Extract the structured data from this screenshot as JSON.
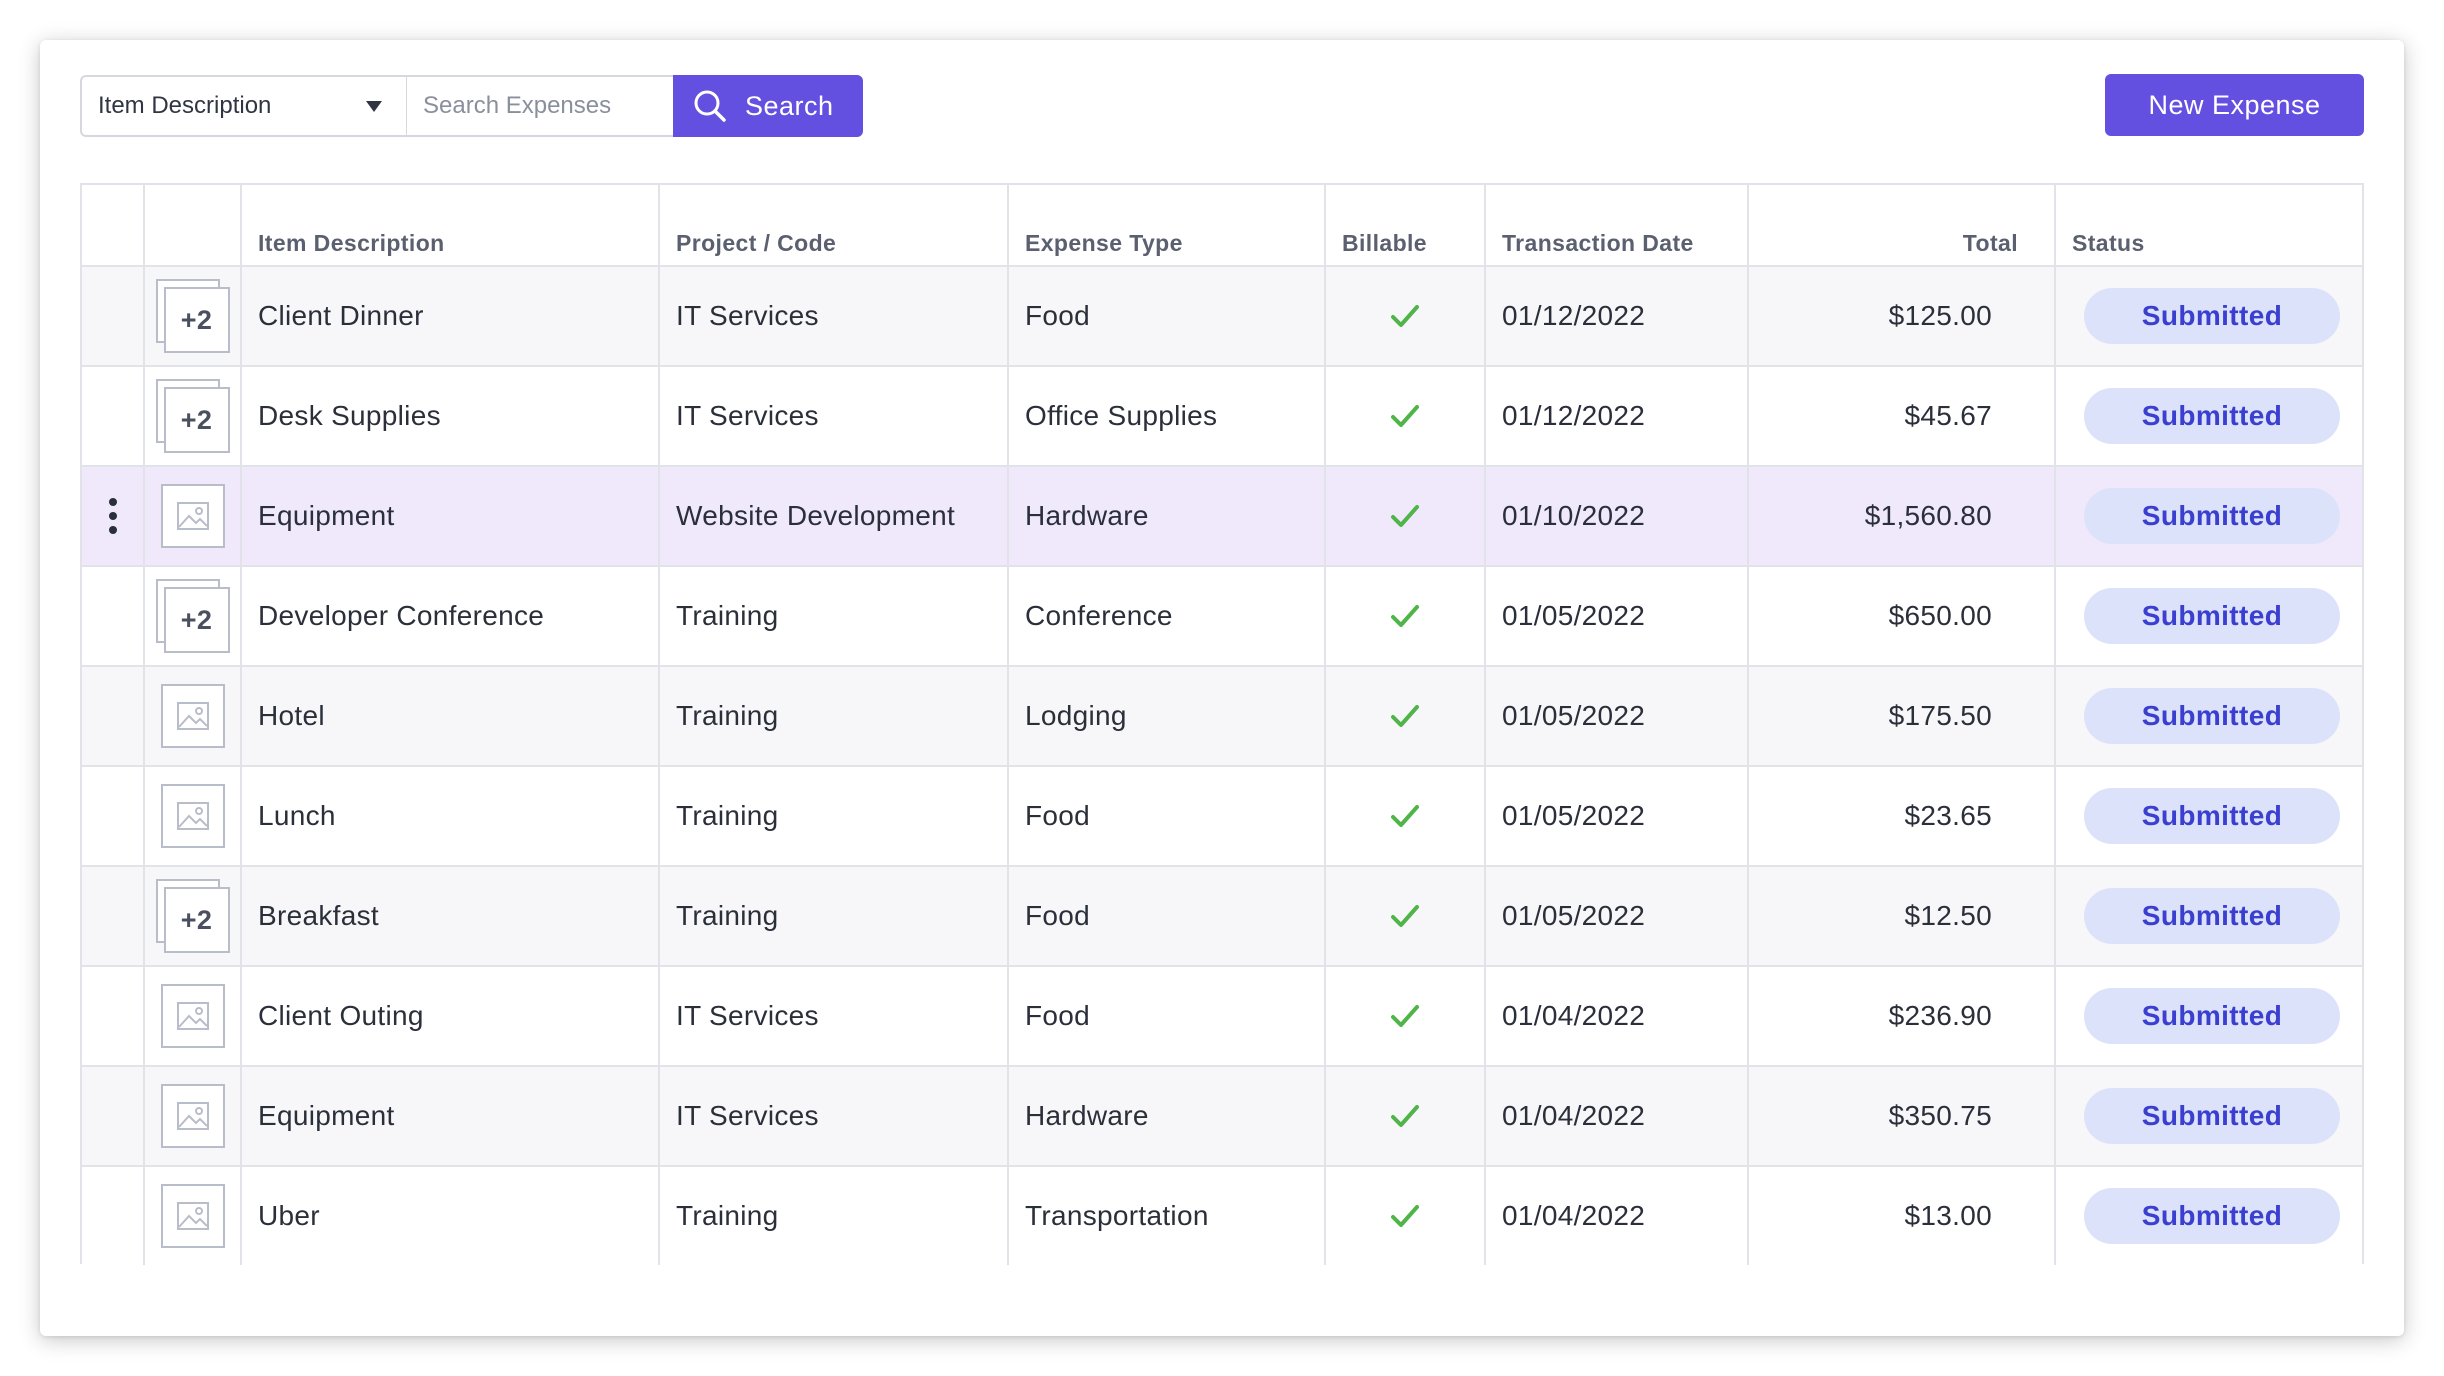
{
  "toolbar": {
    "filter_field": "Item Description",
    "search_placeholder": "Search Expenses",
    "search_label": "Search",
    "new_expense_label": "New Expense"
  },
  "colors": {
    "accent": "#6450e0",
    "badge_bg": "#dde2fb",
    "badge_text": "#3a3fd0",
    "check": "#4fb548",
    "selected_row": "#efe9fb"
  },
  "table": {
    "columns": [
      "Item Description",
      "Project / Code",
      "Expense Type",
      "Billable",
      "Transaction Date",
      "Total",
      "Status"
    ],
    "rows": [
      {
        "attachment": "+2",
        "description": "Client Dinner",
        "project": "IT Services",
        "type": "Food",
        "billable": true,
        "date": "01/12/2022",
        "total": "$125.00",
        "status": "Submitted"
      },
      {
        "attachment": "+2",
        "description": "Desk Supplies",
        "project": "IT Services",
        "type": "Office Supplies",
        "billable": true,
        "date": "01/12/2022",
        "total": "$45.67",
        "status": "Submitted"
      },
      {
        "attachment": "image",
        "description": "Equipment",
        "project": "Website Development",
        "type": "Hardware",
        "billable": true,
        "date": "01/10/2022",
        "total": "$1,560.80",
        "status": "Submitted",
        "selected": true
      },
      {
        "attachment": "+2",
        "description": "Developer Conference",
        "project": "Training",
        "type": "Conference",
        "billable": true,
        "date": "01/05/2022",
        "total": "$650.00",
        "status": "Submitted"
      },
      {
        "attachment": "image",
        "description": "Hotel",
        "project": "Training",
        "type": "Lodging",
        "billable": true,
        "date": "01/05/2022",
        "total": "$175.50",
        "status": "Submitted"
      },
      {
        "attachment": "image",
        "description": "Lunch",
        "project": "Training",
        "type": "Food",
        "billable": true,
        "date": "01/05/2022",
        "total": "$23.65",
        "status": "Submitted"
      },
      {
        "attachment": "+2",
        "description": "Breakfast",
        "project": "Training",
        "type": "Food",
        "billable": true,
        "date": "01/05/2022",
        "total": "$12.50",
        "status": "Submitted"
      },
      {
        "attachment": "image",
        "description": "Client Outing",
        "project": "IT Services",
        "type": "Food",
        "billable": true,
        "date": "01/04/2022",
        "total": "$236.90",
        "status": "Submitted"
      },
      {
        "attachment": "image",
        "description": "Equipment",
        "project": "IT Services",
        "type": "Hardware",
        "billable": true,
        "date": "01/04/2022",
        "total": "$350.75",
        "status": "Submitted"
      },
      {
        "attachment": "image",
        "description": "Uber",
        "project": "Training",
        "type": "Transportation",
        "billable": true,
        "date": "01/04/2022",
        "total": "$13.00",
        "status": "Submitted"
      }
    ]
  }
}
